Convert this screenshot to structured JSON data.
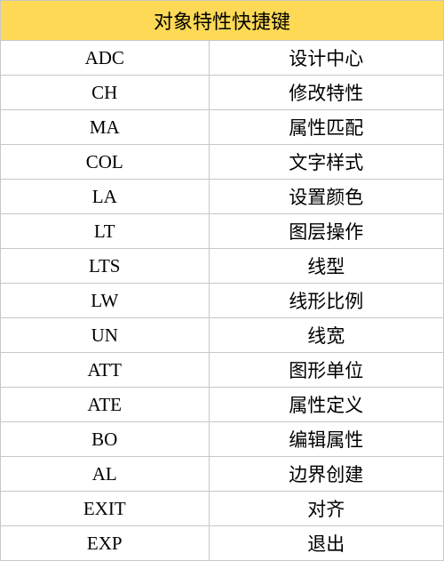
{
  "title": "对象特性快捷键",
  "rows": [
    {
      "key": "ADC",
      "desc": "设计中心"
    },
    {
      "key": "CH",
      "desc": "修改特性"
    },
    {
      "key": "MA",
      "desc": "属性匹配"
    },
    {
      "key": "COL",
      "desc": "文字样式"
    },
    {
      "key": "LA",
      "desc": "设置颜色"
    },
    {
      "key": "LT",
      "desc": "图层操作"
    },
    {
      "key": "LTS",
      "desc": "线型"
    },
    {
      "key": "LW",
      "desc": "线形比例"
    },
    {
      "key": "UN",
      "desc": "线宽"
    },
    {
      "key": "ATT",
      "desc": "图形单位"
    },
    {
      "key": "ATE",
      "desc": "属性定义"
    },
    {
      "key": "BO",
      "desc": "编辑属性"
    },
    {
      "key": "AL",
      "desc": "边界创建"
    },
    {
      "key": "EXIT",
      "desc": "对齐"
    },
    {
      "key": "EXP",
      "desc": "退出"
    }
  ]
}
